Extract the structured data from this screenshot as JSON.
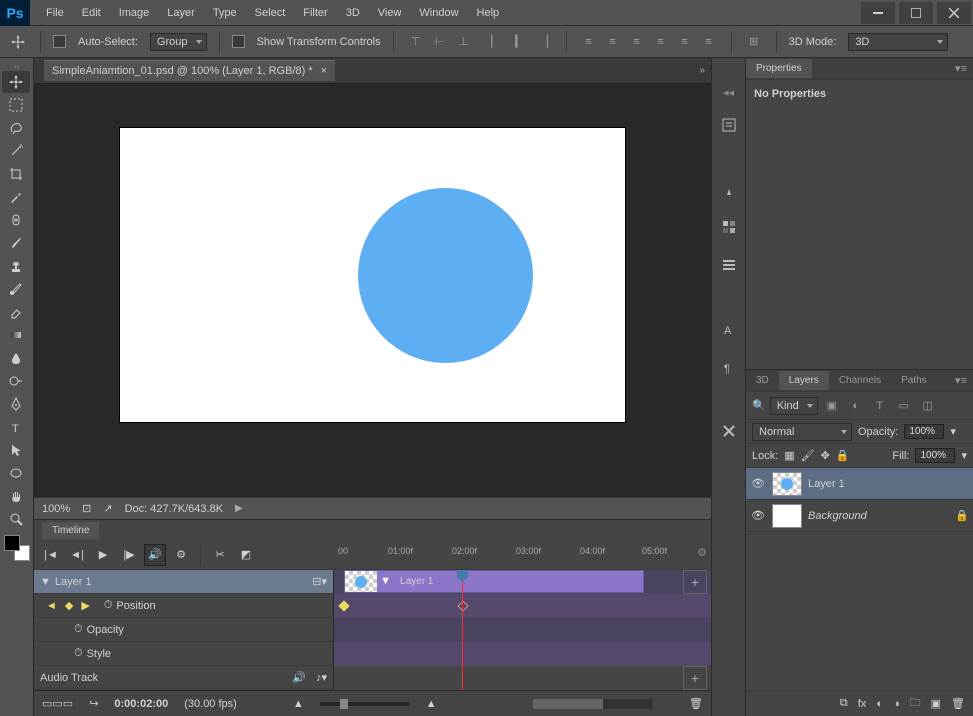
{
  "menubar": [
    "File",
    "Edit",
    "Image",
    "Layer",
    "Type",
    "Select",
    "Filter",
    "3D",
    "View",
    "Window",
    "Help"
  ],
  "optionsbar": {
    "auto_select": "Auto-Select:",
    "group": "Group",
    "show_transform": "Show Transform Controls",
    "mode_label": "3D Mode:",
    "mode_value": "3D"
  },
  "document": {
    "tab_title": "SimpleAniamtion_01.psd @ 100% (Layer 1, RGB/8) *",
    "zoom": "100%",
    "doc_size": "Doc: 427.7K/643.8K"
  },
  "timeline": {
    "panel_name": "Timeline",
    "ruler": [
      "00",
      "01:00f",
      "02:00f",
      "03:00f",
      "04:00f",
      "05:00f"
    ],
    "layer_name": "Layer 1",
    "clip_label": "Layer 1",
    "props": [
      "Position",
      "Opacity",
      "Style"
    ],
    "audio": "Audio Track",
    "current_time": "0:00:02:00",
    "fps": "(30.00 fps)"
  },
  "properties": {
    "tab": "Properties",
    "body": "No Properties"
  },
  "layers_panel": {
    "tabs": [
      "3D",
      "Layers",
      "Channels",
      "Paths"
    ],
    "kind": "Kind",
    "blend": "Normal",
    "opacity_label": "Opacity:",
    "opacity_val": "100%",
    "lock_label": "Lock:",
    "fill_label": "Fill:",
    "fill_val": "100%",
    "layers": [
      {
        "name": "Layer 1",
        "selected": true,
        "locked": false
      },
      {
        "name": "Background",
        "selected": false,
        "locked": true
      }
    ]
  }
}
